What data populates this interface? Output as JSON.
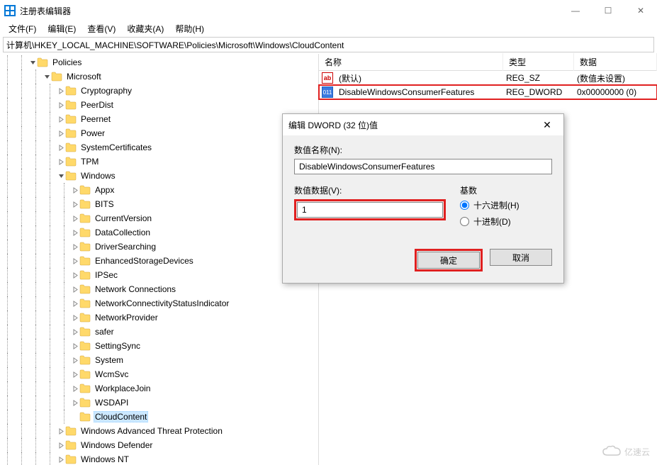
{
  "window": {
    "title": "注册表编辑器",
    "controls": {
      "min": "—",
      "max": "☐",
      "close": "✕"
    }
  },
  "menu": {
    "file": "文件(F)",
    "edit": "编辑(E)",
    "view": "查看(V)",
    "favorites": "收藏夹(A)",
    "help": "帮助(H)"
  },
  "address": "计算机\\HKEY_LOCAL_MACHINE\\SOFTWARE\\Policies\\Microsoft\\Windows\\CloudContent",
  "tree": {
    "policies": "Policies",
    "microsoft": "Microsoft",
    "items": [
      "Cryptography",
      "PeerDist",
      "Peernet",
      "Power",
      "SystemCertificates",
      "TPM"
    ],
    "windows": "Windows",
    "win_items": [
      "Appx",
      "BITS",
      "CurrentVersion",
      "DataCollection",
      "DriverSearching",
      "EnhancedStorageDevices",
      "IPSec",
      "Network Connections",
      "NetworkConnectivityStatusIndicator",
      "NetworkProvider",
      "safer",
      "SettingSync",
      "System",
      "WcmSvc",
      "WorkplaceJoin",
      "WSDAPI",
      "CloudContent"
    ],
    "after": [
      "Windows Advanced Threat Protection",
      "Windows Defender",
      "Windows NT"
    ]
  },
  "list": {
    "headers": {
      "name": "名称",
      "type": "类型",
      "data": "数据"
    },
    "rows": [
      {
        "icon": "str",
        "name": "(默认)",
        "type": "REG_SZ",
        "data": "(数值未设置)"
      },
      {
        "icon": "dword",
        "name": "DisableWindowsConsumerFeatures",
        "type": "REG_DWORD",
        "data": "0x00000000 (0)",
        "highlight": true
      }
    ]
  },
  "dialog": {
    "title": "编辑 DWORD (32 位)值",
    "name_label": "数值名称(N):",
    "name_value": "DisableWindowsConsumerFeatures",
    "data_label": "数值数据(V):",
    "data_value": "1",
    "base_label": "基数",
    "hex": "十六进制(H)",
    "dec": "十进制(D)",
    "ok": "确定",
    "cancel": "取消"
  },
  "watermark": "亿速云"
}
